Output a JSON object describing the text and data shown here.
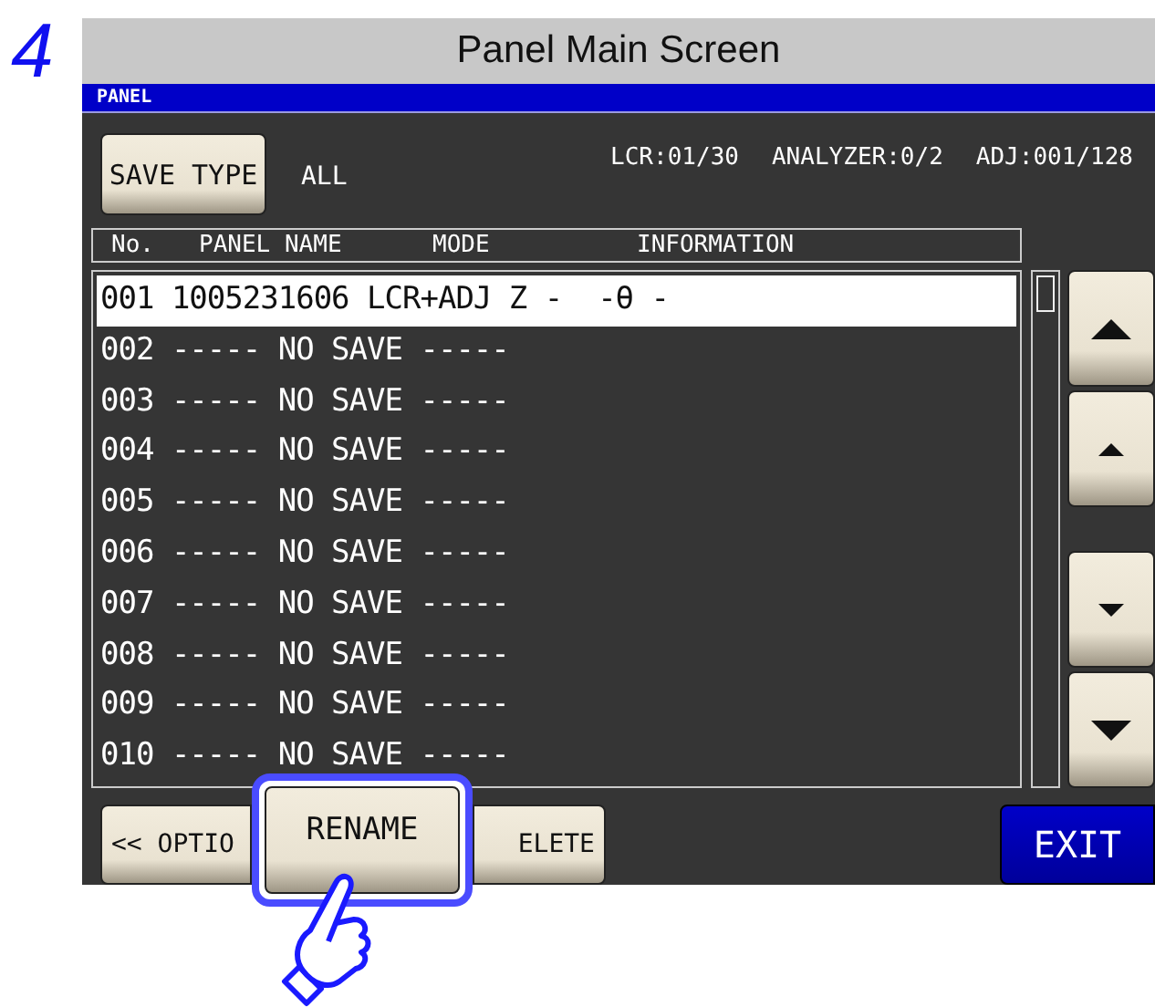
{
  "step": "4",
  "screen_title": "Panel Main Screen",
  "window_bar": {
    "title": "PANEL"
  },
  "save_type": {
    "button": "SAVE TYPE",
    "value": "ALL"
  },
  "counts": [
    "LCR:01/30",
    "ANALYZER:0/2",
    "ADJ:001/128"
  ],
  "columns": [
    "No.",
    "PANEL NAME",
    "MODE",
    "INFORMATION"
  ],
  "rows": [
    {
      "text": "001 1005231606 LCR+ADJ Z -  -θ -",
      "selected": true
    },
    {
      "text": "002 ----- NO SAVE -----",
      "selected": false
    },
    {
      "text": "003 ----- NO SAVE -----",
      "selected": false
    },
    {
      "text": "004 ----- NO SAVE -----",
      "selected": false
    },
    {
      "text": "005 ----- NO SAVE -----",
      "selected": false
    },
    {
      "text": "006 ----- NO SAVE -----",
      "selected": false
    },
    {
      "text": "007 ----- NO SAVE -----",
      "selected": false
    },
    {
      "text": "008 ----- NO SAVE -----",
      "selected": false
    },
    {
      "text": "009 ----- NO SAVE -----",
      "selected": false
    },
    {
      "text": "010 ----- NO SAVE -----",
      "selected": false
    }
  ],
  "scroll_buttons": [
    {
      "kind": "page-up"
    },
    {
      "kind": "up"
    },
    {
      "kind": "down"
    },
    {
      "kind": "page-down"
    }
  ],
  "bottom_buttons": [
    {
      "kind": "option",
      "label": "<< OPTIO"
    },
    {
      "kind": "delete",
      "label": "ELETE"
    },
    {
      "kind": "exit",
      "label": "EXIT"
    }
  ],
  "rename": {
    "label": "RENAME",
    "highlighted": true
  }
}
